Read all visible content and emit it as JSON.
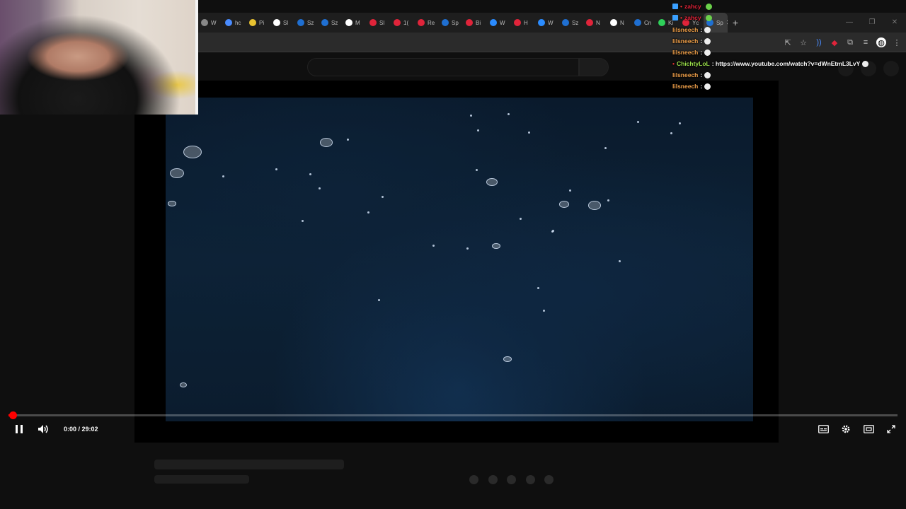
{
  "browser": {
    "tabs": [
      {
        "label": "W",
        "color": "#888888"
      },
      {
        "label": "hc",
        "color": "#4a8cff"
      },
      {
        "label": "Pi",
        "color": "#e8c230"
      },
      {
        "label": "Sl",
        "color": "#ffffff"
      },
      {
        "label": "Sz",
        "color": "#1f6fd1"
      },
      {
        "label": "Sz",
        "color": "#1f6fd1"
      },
      {
        "label": "M",
        "color": "#ffffff"
      },
      {
        "label": "Sl",
        "color": "#e0243a"
      },
      {
        "label": "1(",
        "color": "#e0243a"
      },
      {
        "label": "Re",
        "color": "#e0243a"
      },
      {
        "label": "Sp",
        "color": "#1f6fd1"
      },
      {
        "label": "Bi",
        "color": "#e0243a"
      },
      {
        "label": "W",
        "color": "#2b8cff"
      },
      {
        "label": "H",
        "color": "#e0243a"
      },
      {
        "label": "W",
        "color": "#2b8cff"
      },
      {
        "label": "Sz",
        "color": "#1f6fd1"
      },
      {
        "label": "N",
        "color": "#e0243a"
      },
      {
        "label": "N",
        "color": "#ffffff"
      },
      {
        "label": "Cn",
        "color": "#1f6fd1"
      },
      {
        "label": "Ki",
        "color": "#2fd05a"
      },
      {
        "label": "Yc",
        "color": "#e0243a"
      },
      {
        "label": "Sp",
        "color": "#1f6fd1",
        "active": true
      }
    ],
    "close_tab": "✕",
    "new_tab": "+"
  },
  "player": {
    "time": "0:00 / 29:02",
    "progress": 0.0,
    "play_state": "playing"
  },
  "chat": [
    {
      "name": "zahcy",
      "message": "",
      "name_color": "#e0243a",
      "badge": true,
      "bullet": true
    },
    {
      "name": "zahcy",
      "message": "",
      "name_color": "#e0243a",
      "badge": true,
      "bullet": true
    },
    {
      "name": "lilsneech",
      "message": ":",
      "name_color": "#f0a04a"
    },
    {
      "name": "lilsneech",
      "message": ":",
      "name_color": "#f0a04a"
    },
    {
      "name": "lilsneech",
      "message": ":",
      "name_color": "#f0a04a"
    },
    {
      "name": "ChichtyLoL",
      "message": ": https://www.youtube.com/watch?v=dWnEtmL3LvY",
      "name_color": "#9be04a",
      "bullet": true
    },
    {
      "name": "lilsneech",
      "message": ":",
      "name_color": "#f0a04a"
    },
    {
      "name": "lilsneech",
      "message": ":",
      "name_color": "#f0a04a"
    }
  ]
}
